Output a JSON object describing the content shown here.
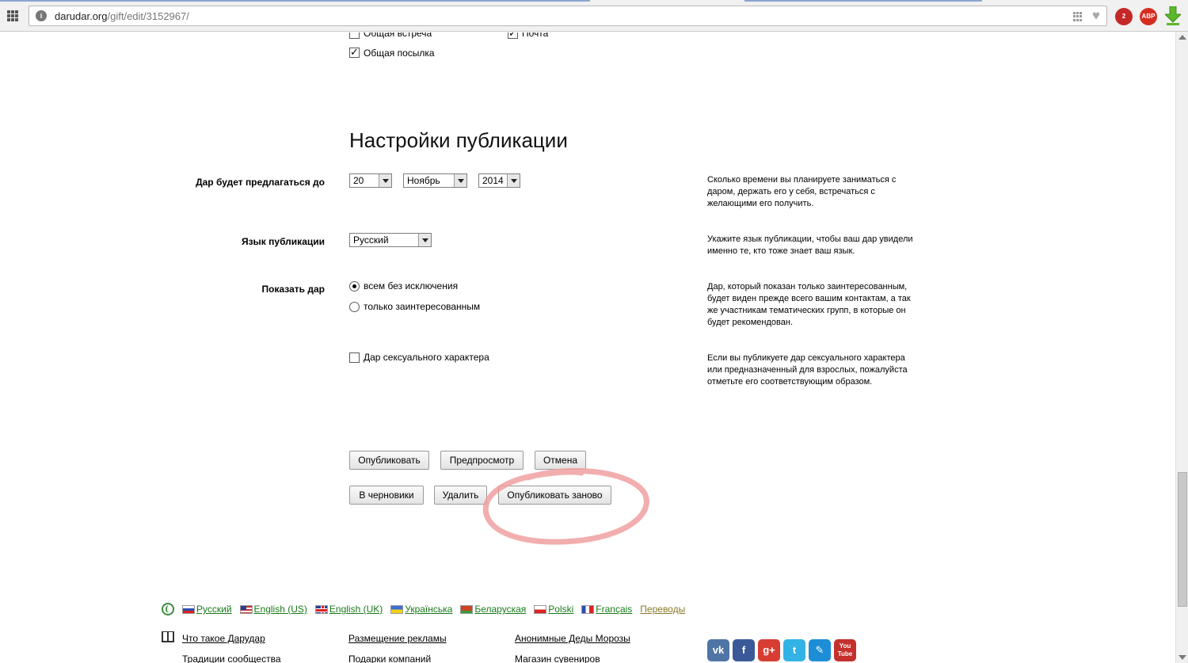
{
  "browser": {
    "url_domain": "darudar.org",
    "url_path": "/gift/edit/3152967/",
    "ext_alert_badge": "2",
    "ext_abp_label": "ABP"
  },
  "delivery": {
    "meeting_label": "Общая встреча",
    "meeting_checked": false,
    "mail_label": "Почта",
    "mail_checked": true,
    "parcel_label": "Общая посылка",
    "parcel_checked": true
  },
  "publication": {
    "section_title": "Настройки публикации",
    "offer_until": {
      "label": "Дар будет предлагаться до",
      "day": "20",
      "month": "Ноябрь",
      "year": "2014",
      "hint": "Сколько времени вы планируете заниматься с даром, держать его у себя, встречаться с желающими его получить."
    },
    "language": {
      "label": "Язык публикации",
      "value": "Русский",
      "hint": "Укажите язык публикации, чтобы ваш дар увидели именно те, кто тоже знает ваш язык."
    },
    "visibility": {
      "label": "Показать дар",
      "option_all": "всем без исключения",
      "option_interested": "только заинтересованным",
      "selected": "all",
      "hint": "Дар, который показан только заинтересованным, будет виден прежде всего вашим контактам, а так же участникам тематических групп, в которые он будет рекомендован."
    },
    "adult": {
      "label": "Дар сексуального характера",
      "checked": false,
      "hint": "Если вы публикуете дар сексуального характера или предназначенный для взрослых, пожалуйста отметьте его соответствующим образом."
    }
  },
  "actions": {
    "publish": "Опубликовать",
    "preview": "Предпросмотр",
    "cancel": "Отмена",
    "drafts": "В черновики",
    "delete": "Удалить",
    "republish": "Опубликовать заново"
  },
  "annotation_color": "#f0a0a0",
  "footer": {
    "languages": [
      {
        "label": "Русский"
      },
      {
        "label": "English (US)"
      },
      {
        "label": "English (UK)"
      },
      {
        "label": "Українська"
      },
      {
        "label": "Беларуская"
      },
      {
        "label": "Polski"
      },
      {
        "label": "Français"
      }
    ],
    "translations": "Переводы",
    "links_col1": [
      "Что такое Дарудар",
      "Традиции сообщества"
    ],
    "links_col2": [
      "Размещение рекламы",
      "Подарки компаний"
    ],
    "links_col3": [
      "Анонимные Деды Морозы",
      "Магазин сувениров"
    ],
    "social": {
      "vk": "vk",
      "fb": "f",
      "gp": "g+",
      "tw": "t",
      "lj": "✎",
      "yt_top": "You",
      "yt_bottom": "Tube"
    }
  }
}
